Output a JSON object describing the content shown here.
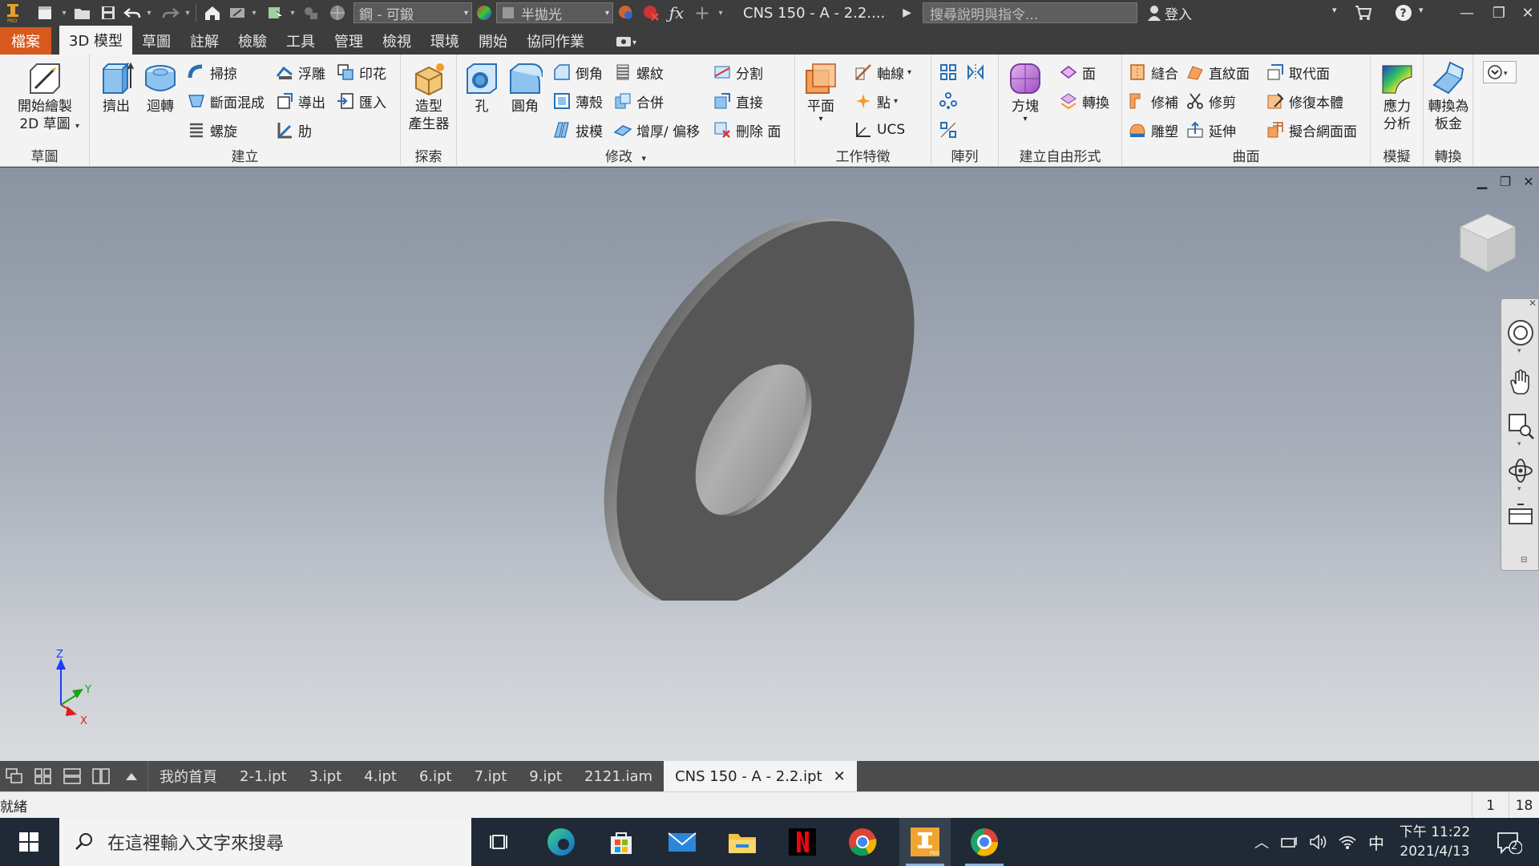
{
  "app": {
    "document_title": "CNS 150 - A - 2.2....",
    "help_search_placeholder": "搜尋說明與指令...",
    "sign_in_label": "登入",
    "material_combo": "鋼 - 可鍛",
    "appearance_combo": "半拋光"
  },
  "menu": {
    "tabs": [
      "檔案",
      "3D 模型",
      "草圖",
      "註解",
      "檢驗",
      "工具",
      "管理",
      "檢視",
      "環境",
      "開始",
      "協同作業"
    ],
    "active_index": 1
  },
  "ribbon": {
    "sketch": {
      "title": "草圖",
      "start_2d_sketch": [
        "開始繪製",
        "2D 草圖"
      ]
    },
    "create": {
      "title": "建立",
      "extrude": "擠出",
      "revolve": "迴轉",
      "sweep": "掃掠",
      "loft": "斷面混成",
      "coil": "螺旋",
      "emboss": "浮雕",
      "derive": "導出",
      "rib": "肋",
      "decal": "印花",
      "import": "匯入"
    },
    "explore": {
      "title": "探索",
      "shape_generator": [
        "造型",
        "產生器"
      ]
    },
    "modify": {
      "title": "修改",
      "hole": "孔",
      "fillet": "圓角",
      "chamfer": "倒角",
      "shell": "薄殼",
      "draft": "拔模",
      "thread": "螺紋",
      "combine": "合併",
      "thicken": "增厚/ 偏移",
      "split": "分割",
      "direct": "直接",
      "delete_face": "刪除 面"
    },
    "work_features": {
      "title": "工作特徵",
      "plane": "平面",
      "axis": "軸線",
      "point": "點",
      "ucs": "UCS"
    },
    "pattern": {
      "title": "陣列"
    },
    "freeform": {
      "title": "建立自由形式",
      "box": "方塊",
      "face": "面",
      "convert": "轉換"
    },
    "surface": {
      "title": "曲面",
      "stitch": "縫合",
      "patch": "修補",
      "sculpt": "雕塑",
      "ruled": "直紋面",
      "trim": "修剪",
      "extend": "延伸",
      "replace_face": "取代面",
      "repair_bodies": "修復本體",
      "fit_mesh_face": "擬合網面面"
    },
    "simulation": {
      "title": "模擬",
      "stress_analysis": [
        "應力",
        "分析"
      ]
    },
    "convert": {
      "title": "轉換",
      "sheet_metal": [
        "轉換為",
        "板金"
      ]
    }
  },
  "triad": {
    "x": "X",
    "y": "Y",
    "z": "Z"
  },
  "doc_tabs": {
    "items": [
      "我的首頁",
      "2-1.ipt",
      "3.ipt",
      "4.ipt",
      "6.ipt",
      "7.ipt",
      "9.ipt",
      "2121.iam",
      "CNS 150 - A - 2.2.ipt"
    ],
    "active_index": 8
  },
  "status": {
    "text": "就緒",
    "count_a": "1",
    "count_b": "18"
  },
  "taskbar": {
    "search_placeholder": "在這裡輸入文字來搜尋",
    "clock_time": "下午 11:22",
    "clock_date": "2021/4/13",
    "ime": "中",
    "notifications": "2"
  },
  "colors": {
    "file_tab": "#d7591c",
    "ribbon_bg": "#f3f3f3",
    "part": "#555555",
    "taskbar": "#1f2a36"
  }
}
